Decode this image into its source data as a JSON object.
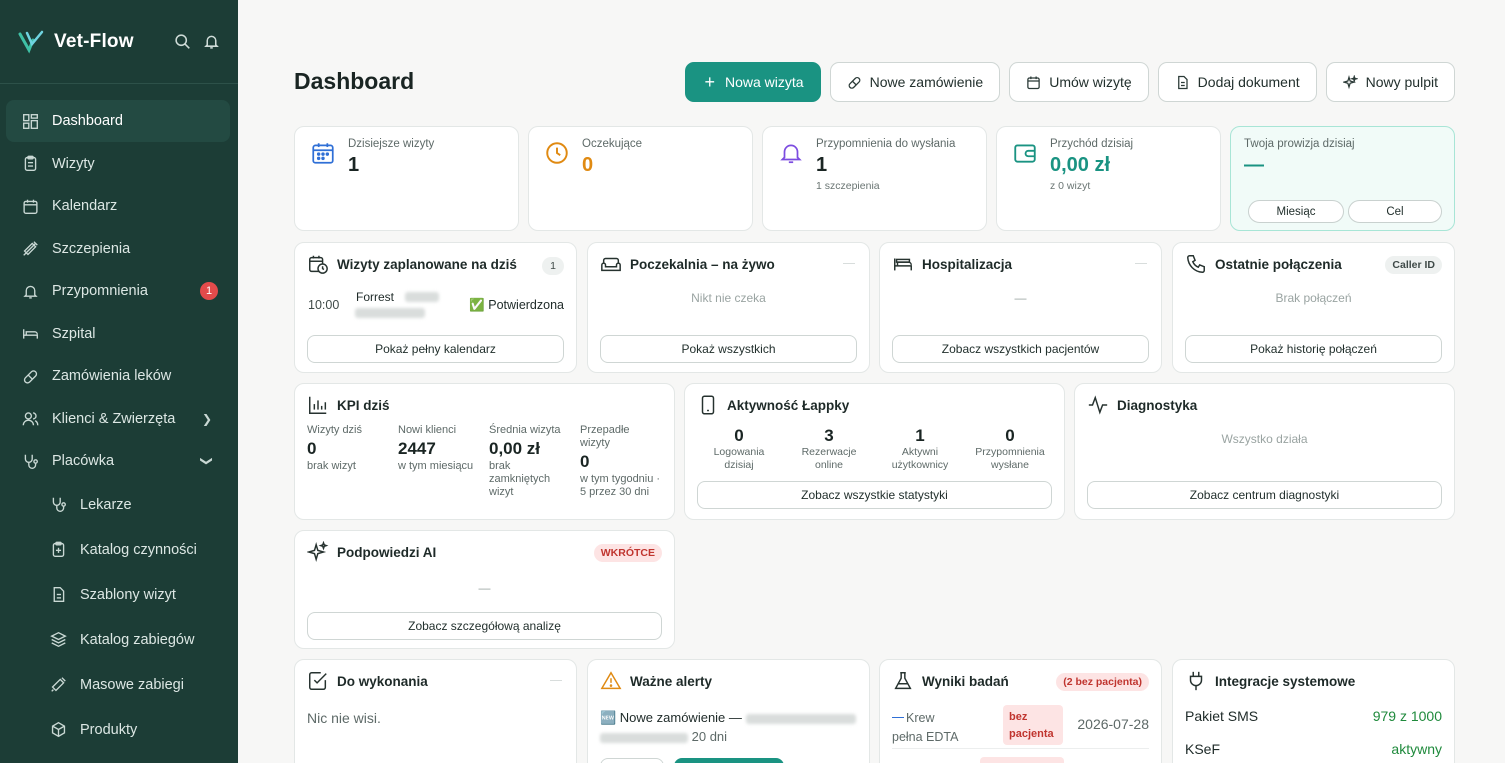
{
  "app": {
    "name": "Vet-Flow"
  },
  "sidebar": {
    "items": [
      {
        "label": "Dashboard"
      },
      {
        "label": "Wizyty"
      },
      {
        "label": "Kalendarz"
      },
      {
        "label": "Szczepienia"
      },
      {
        "label": "Przypomnienia",
        "badge": "1"
      },
      {
        "label": "Szpital"
      },
      {
        "label": "Zamówienia leków"
      },
      {
        "label": "Klienci & Zwierzęta"
      },
      {
        "label": "Placówka"
      },
      {
        "label": "Lekarze"
      },
      {
        "label": "Katalog czynności"
      },
      {
        "label": "Szablony wizyt"
      },
      {
        "label": "Katalog zabiegów"
      },
      {
        "label": "Masowe zabiegi"
      },
      {
        "label": "Produkty"
      }
    ]
  },
  "header": {
    "title": "Dashboard",
    "buttons": {
      "new_visit": "Nowa wizyta",
      "new_order": "Nowe zamówienie",
      "schedule": "Umów wizytę",
      "add_doc": "Dodaj dokument",
      "new_desk": "Nowy pulpit"
    }
  },
  "stats": [
    {
      "label": "Dzisiejsze wizyty",
      "value": "1"
    },
    {
      "label": "Oczekujące",
      "value": "0"
    },
    {
      "label": "Przypomnienia do wysłania",
      "value": "1",
      "sub": "1 szczepienia"
    },
    {
      "label": "Przychód dzisiaj",
      "value": "0,00 zł",
      "sub": "z 0 wizyt"
    },
    {
      "label": "Twoja prowizja dzisiaj",
      "value": "—",
      "btn_month": "Miesiąc",
      "btn_goal": "Cel"
    }
  ],
  "visits": {
    "title": "Wizyty zaplanowane na dziś",
    "count": "1",
    "row": {
      "time": "10:00",
      "patient": "Forrest",
      "status": "✅ Potwierdzona"
    },
    "button": "Pokaż pełny kalendarz"
  },
  "waiting": {
    "title": "Poczekalnia – na żywo",
    "empty": "Nikt nie czeka",
    "button": "Pokaż wszystkich"
  },
  "hospital": {
    "title": "Hospitalizacja",
    "empty": "—",
    "button": "Zobacz wszystkich pacjentów"
  },
  "calls": {
    "title": "Ostatnie połączenia",
    "tag": "Caller ID",
    "empty": "Brak połączeń",
    "button": "Pokaż historię połączeń"
  },
  "kpi": {
    "title": "KPI dziś",
    "cols": [
      {
        "label": "Wizyty dziś",
        "value": "0",
        "sub": "brak wizyt"
      },
      {
        "label": "Nowi klienci",
        "value": "2447",
        "sub": "w tym miesiącu"
      },
      {
        "label": "Średnia wizyta",
        "value": "0,00 zł",
        "sub": "brak zamkniętych wizyt"
      },
      {
        "label": "Przepadłe wizyty",
        "value": "0",
        "sub": "w tym tygodniu · 5 przez 30 dni"
      }
    ]
  },
  "activity": {
    "title": "Aktywność Łappky",
    "cols": [
      {
        "value": "0",
        "label": "Logowania dzisiaj"
      },
      {
        "value": "3",
        "label": "Rezerwacje online"
      },
      {
        "value": "1",
        "label": "Aktywni użytkownicy"
      },
      {
        "value": "0",
        "label": "Przypomnienia wysłane"
      }
    ],
    "button": "Zobacz wszystkie statystyki"
  },
  "diag": {
    "title": "Diagnostyka",
    "empty": "Wszystko działa",
    "button": "Zobacz centrum diagnostyki"
  },
  "ai": {
    "title": "Podpowiedzi AI",
    "tag": "WKRÓTCE",
    "empty": "—",
    "button": "Zobacz szczegółową analizę"
  },
  "todo": {
    "title": "Do wykonania",
    "empty": "Nic nie wisi."
  },
  "alerts": {
    "title": "Ważne alerty",
    "line1": "🆕 Nowe zamówienie —",
    "line2": "20 dni"
  },
  "results": {
    "title": "Wyniki badań",
    "tag": "(2 bez pacjenta)",
    "row": {
      "name": "Krew pełna EDTA",
      "badge": "bez pacjenta",
      "date": "2026-07-28"
    }
  },
  "integrations": {
    "title": "Integracje systemowe",
    "rows": [
      {
        "name": "Pakiet SMS",
        "value": "979 z 1000"
      },
      {
        "name": "KSeF",
        "value": "aktywny"
      }
    ]
  },
  "colors": {
    "sidebar": "#1c3d36",
    "accent": "#1a9382",
    "warning": "#e08a12",
    "danger": "#e34b4b"
  }
}
